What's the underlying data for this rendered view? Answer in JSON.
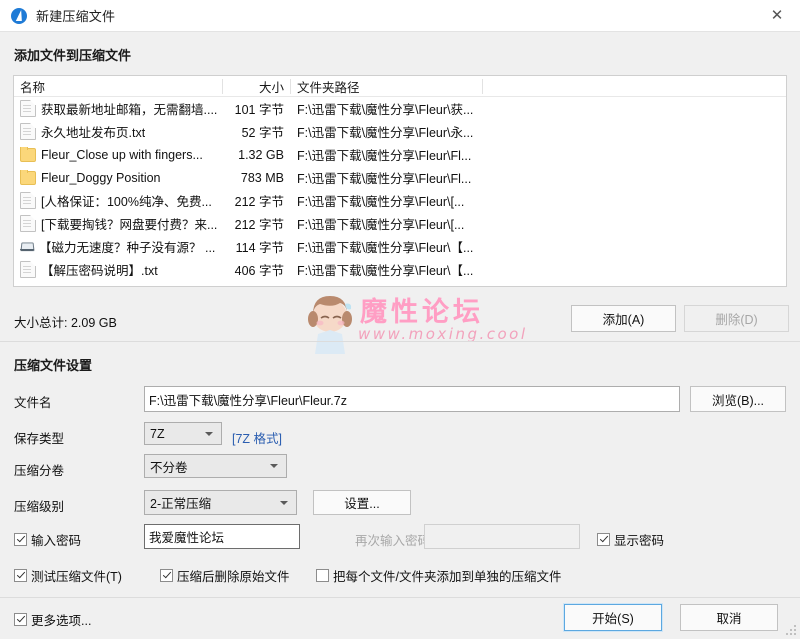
{
  "window": {
    "title": "新建压缩文件",
    "icon": "bandizip-bolt-icon",
    "close_label": "✕"
  },
  "add_section": {
    "title": "添加文件到压缩文件",
    "columns": {
      "name": "名称",
      "size": "大小",
      "path": "文件夹路径"
    },
    "rows": [
      {
        "icon": "file-icon",
        "name": "获取最新地址邮箱，无需翻墙....",
        "size": "101 字节",
        "path": "F:\\迅雷下载\\魔性分享\\Fleur\\获..."
      },
      {
        "icon": "file-icon",
        "name": "永久地址发布页.txt",
        "size": "52 字节",
        "path": "F:\\迅雷下载\\魔性分享\\Fleur\\永..."
      },
      {
        "icon": "folder-icon",
        "name": "Fleur_Close up with fingers...",
        "size": "1.32 GB",
        "path": "F:\\迅雷下载\\魔性分享\\Fleur\\Fl..."
      },
      {
        "icon": "folder-icon",
        "name": "Fleur_Doggy Position",
        "size": "783 MB",
        "path": "F:\\迅雷下载\\魔性分享\\Fleur\\Fl..."
      },
      {
        "icon": "file-icon",
        "name": "[人格保证：100%纯净、免费...",
        "size": "212 字节",
        "path": "F:\\迅雷下载\\魔性分享\\Fleur\\[..."
      },
      {
        "icon": "file-icon",
        "name": "[下载要掏钱？网盘要付费？来...",
        "size": "212 字节",
        "path": "F:\\迅雷下载\\魔性分享\\Fleur\\[..."
      },
      {
        "icon": "shortcut-icon",
        "name": "【磁力无速度？种子没有源？ ...",
        "size": "114 字节",
        "path": "F:\\迅雷下载\\魔性分享\\Fleur\\【..."
      },
      {
        "icon": "file-icon",
        "name": "【解压密码说明】.txt",
        "size": "406 字节",
        "path": "F:\\迅雷下载\\魔性分享\\Fleur\\【..."
      }
    ],
    "size_total": "大小总计: 2.09 GB",
    "add_button": "添加(A)",
    "delete_button": "删除(D)"
  },
  "watermark": {
    "text": "魔性论坛",
    "url": "www.moxing.cool",
    "color": "#ff9ec4"
  },
  "settings_section": {
    "title": "压缩文件设置",
    "filename_label": "文件名",
    "filename_value": "F:\\迅雷下载\\魔性分享\\Fleur\\Fleur.7z",
    "browse_button": "浏览(B)...",
    "savetype_label": "保存类型",
    "savetype_value": "7Z",
    "format_link": "[7Z 格式]",
    "volume_label": "压缩分卷",
    "volume_value": "不分卷",
    "level_label": "压缩级别",
    "level_value": "2-正常压缩",
    "settings_button": "设置...",
    "password_checkbox": "输入密码",
    "password_value": "我爱魔性论坛",
    "password_confirm_label": "再次输入密码",
    "password_confirm_value": "",
    "show_password_checkbox": "显示密码",
    "test_archive_checkbox": "测试压缩文件(T)",
    "delete_after_checkbox": "压缩后删除原始文件",
    "separate_archives_checkbox": "把每个文件/文件夹添加到单独的压缩文件"
  },
  "footer": {
    "more_options_checkbox": "更多选项...",
    "start_button": "开始(S)",
    "cancel_button": "取消"
  }
}
